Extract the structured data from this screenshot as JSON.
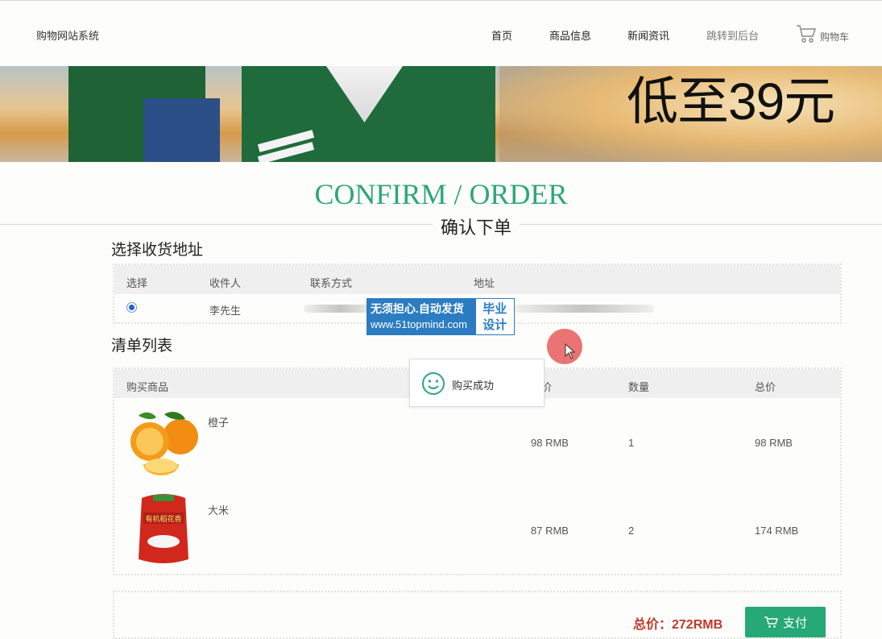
{
  "header": {
    "brand": "购物网站系统",
    "nav": [
      "首页",
      "商品信息",
      "新闻资讯",
      "跳转到后台"
    ],
    "cart_label": "购物车"
  },
  "banner": {
    "promo": "低至39元"
  },
  "page": {
    "title_en": "CONFIRM / ORDER",
    "title_cn": "确认下单"
  },
  "address": {
    "section_title": "选择收货地址",
    "columns": [
      "选择",
      "收件人",
      "联系方式",
      "地址"
    ],
    "rows": [
      {
        "recipient": "李先生",
        "selected": true
      }
    ]
  },
  "cart_list": {
    "section_title": "清单列表",
    "columns": [
      "购买商品",
      "单价",
      "数量",
      "总价"
    ],
    "items": [
      {
        "name": "橙子",
        "price": "98 RMB",
        "qty": "1",
        "total": "98 RMB"
      },
      {
        "name": "大米",
        "price": "87 RMB",
        "qty": "2",
        "total": "174 RMB"
      }
    ]
  },
  "watermark": {
    "line1": "无须担心.自动发货",
    "line2": "www.51topmind.com",
    "badge1": "毕业",
    "badge2": "设计"
  },
  "toast": {
    "message": "购买成功"
  },
  "summary": {
    "total_label": "总价：272RMB",
    "pay_label": "支付"
  },
  "colors": {
    "accent": "#27a877",
    "total": "#c0392b"
  }
}
